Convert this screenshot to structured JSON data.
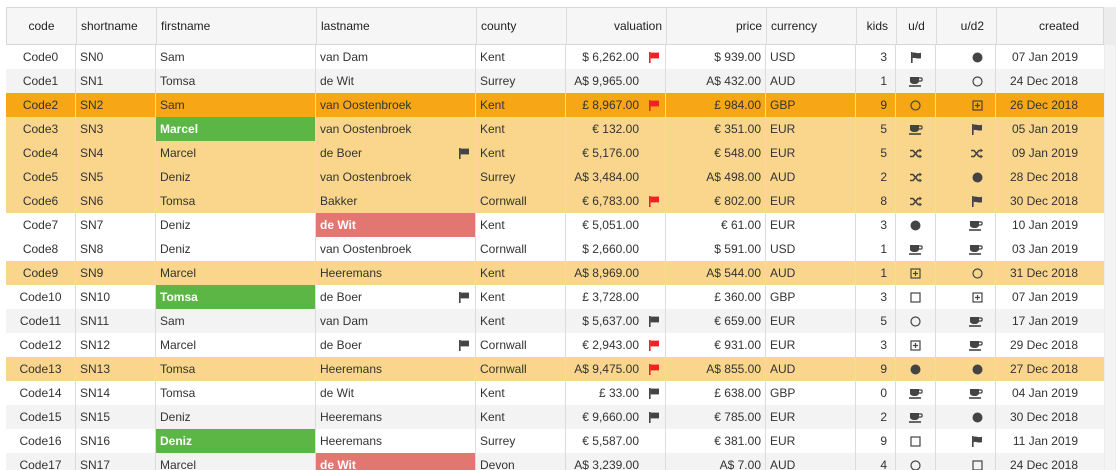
{
  "columns": {
    "code": "code",
    "shortname": "shortname",
    "firstname": "firstname",
    "lastname": "lastname",
    "county": "county",
    "valuation": "valuation",
    "price": "price",
    "currency": "currency",
    "kids": "kids",
    "ud": "u/d",
    "ud2": "u/d2",
    "created": "created"
  },
  "colors": {
    "selected": "#f7a715",
    "highlight": "#f9d68c",
    "green": "#5bb645",
    "red": "#e27670",
    "flag_red": "#ee2222",
    "flag_dark": "#555555"
  },
  "rows": [
    {
      "code": "Code0",
      "short": "SN0",
      "first": "Sam",
      "first_style": "",
      "last": "van Dam",
      "last_style": "",
      "last_flag": "",
      "county": "Kent",
      "val": "$ 6,262.00",
      "val_flag": "red",
      "price": "$ 939.00",
      "cur": "USD",
      "kids": "3",
      "ud": "flag",
      "ud2": "dot",
      "created": "07 Jan 2019",
      "state": "even"
    },
    {
      "code": "Code1",
      "short": "SN1",
      "first": "Tomsa",
      "first_style": "",
      "last": "de Wit",
      "last_style": "",
      "last_flag": "",
      "county": "Surrey",
      "val": "A$ 9,965.00",
      "val_flag": "",
      "price": "A$ 432.00",
      "cur": "AUD",
      "kids": "1",
      "ud": "cup",
      "ud2": "circle",
      "created": "24 Dec 2018",
      "state": "odd"
    },
    {
      "code": "Code2",
      "short": "SN2",
      "first": "Sam",
      "first_style": "",
      "last": "van Oostenbroek",
      "last_style": "",
      "last_flag": "",
      "county": "Kent",
      "val": "£ 8,967.00",
      "val_flag": "red",
      "price": "£ 984.00",
      "cur": "GBP",
      "kids": "9",
      "ud": "circle",
      "ud2": "plus",
      "created": "26 Dec 2018",
      "state": "sel"
    },
    {
      "code": "Code3",
      "short": "SN3",
      "first": "Marcel",
      "first_style": "green",
      "last": "van Oostenbroek",
      "last_style": "",
      "last_flag": "",
      "county": "Kent",
      "val": "€ 132.00",
      "val_flag": "",
      "price": "€ 351.00",
      "cur": "EUR",
      "kids": "5",
      "ud": "cup",
      "ud2": "flag",
      "created": "05 Jan 2019",
      "state": "hl"
    },
    {
      "code": "Code4",
      "short": "SN4",
      "first": "Marcel",
      "first_style": "",
      "last": "de Boer",
      "last_style": "",
      "last_flag": "dark",
      "county": "Kent",
      "val": "€ 5,176.00",
      "val_flag": "",
      "price": "€ 548.00",
      "cur": "EUR",
      "kids": "5",
      "ud": "shuffle",
      "ud2": "shuffle",
      "created": "09 Jan 2019",
      "state": "hl"
    },
    {
      "code": "Code5",
      "short": "SN5",
      "first": "Deniz",
      "first_style": "",
      "last": "van Oostenbroek",
      "last_style": "",
      "last_flag": "",
      "county": "Surrey",
      "val": "A$ 3,484.00",
      "val_flag": "",
      "price": "A$ 498.00",
      "cur": "AUD",
      "kids": "2",
      "ud": "shuffle",
      "ud2": "dot",
      "created": "28 Dec 2018",
      "state": "hl"
    },
    {
      "code": "Code6",
      "short": "SN6",
      "first": "Tomsa",
      "first_style": "",
      "last": "Bakker",
      "last_style": "",
      "last_flag": "",
      "county": "Cornwall",
      "val": "€ 6,783.00",
      "val_flag": "red",
      "price": "€ 802.00",
      "cur": "EUR",
      "kids": "8",
      "ud": "shuffle",
      "ud2": "flag",
      "created": "30 Dec 2018",
      "state": "hl"
    },
    {
      "code": "Code7",
      "short": "SN7",
      "first": "Deniz",
      "first_style": "",
      "last": "de Wit",
      "last_style": "red",
      "last_flag": "",
      "county": "Kent",
      "val": "€ 5,051.00",
      "val_flag": "",
      "price": "€ 61.00",
      "cur": "EUR",
      "kids": "3",
      "ud": "dot",
      "ud2": "cup",
      "created": "10 Jan 2019",
      "state": "even"
    },
    {
      "code": "Code8",
      "short": "SN8",
      "first": "Deniz",
      "first_style": "",
      "last": "van Oostenbroek",
      "last_style": "",
      "last_flag": "",
      "county": "Cornwall",
      "val": "$ 2,660.00",
      "val_flag": "",
      "price": "$ 591.00",
      "cur": "USD",
      "kids": "1",
      "ud": "cup",
      "ud2": "cup",
      "created": "03 Jan 2019",
      "state": "even"
    },
    {
      "code": "Code9",
      "short": "SN9",
      "first": "Marcel",
      "first_style": "",
      "last": "Heeremans",
      "last_style": "",
      "last_flag": "",
      "county": "Kent",
      "val": "A$ 8,969.00",
      "val_flag": "",
      "price": "A$ 544.00",
      "cur": "AUD",
      "kids": "1",
      "ud": "plus",
      "ud2": "circle",
      "created": "31 Dec 2018",
      "state": "hl"
    },
    {
      "code": "Code10",
      "short": "SN10",
      "first": "Tomsa",
      "first_style": "green",
      "last": "de Boer",
      "last_style": "",
      "last_flag": "dark",
      "county": "Kent",
      "val": "£ 3,728.00",
      "val_flag": "",
      "price": "£ 360.00",
      "cur": "GBP",
      "kids": "3",
      "ud": "square",
      "ud2": "plus",
      "created": "07 Jan 2019",
      "state": "even"
    },
    {
      "code": "Code11",
      "short": "SN11",
      "first": "Sam",
      "first_style": "",
      "last": "van Dam",
      "last_style": "",
      "last_flag": "",
      "county": "Kent",
      "val": "$ 5,637.00",
      "val_flag": "dark",
      "price": "€ 659.00",
      "cur": "EUR",
      "kids": "5",
      "ud": "circle",
      "ud2": "cup",
      "created": "17 Jan 2019",
      "state": "odd"
    },
    {
      "code": "Code12",
      "short": "SN12",
      "first": "Marcel",
      "first_style": "",
      "last": "de Boer",
      "last_style": "",
      "last_flag": "dark",
      "county": "Cornwall",
      "val": "€ 2,943.00",
      "val_flag": "red",
      "price": "€ 931.00",
      "cur": "EUR",
      "kids": "3",
      "ud": "plus",
      "ud2": "cup",
      "created": "29 Dec 2018",
      "state": "even"
    },
    {
      "code": "Code13",
      "short": "SN13",
      "first": "Tomsa",
      "first_style": "",
      "last": "Heeremans",
      "last_style": "",
      "last_flag": "",
      "county": "Cornwall",
      "val": "A$ 9,475.00",
      "val_flag": "red",
      "price": "A$ 855.00",
      "cur": "AUD",
      "kids": "9",
      "ud": "dot",
      "ud2": "dot",
      "created": "27 Dec 2018",
      "state": "hl"
    },
    {
      "code": "Code14",
      "short": "SN14",
      "first": "Tomsa",
      "first_style": "",
      "last": "de Wit",
      "last_style": "",
      "last_flag": "",
      "county": "Kent",
      "val": "£ 33.00",
      "val_flag": "dark",
      "price": "£ 638.00",
      "cur": "GBP",
      "kids": "0",
      "ud": "cup",
      "ud2": "cup",
      "created": "04 Jan 2019",
      "state": "even"
    },
    {
      "code": "Code15",
      "short": "SN15",
      "first": "Deniz",
      "first_style": "",
      "last": "Heeremans",
      "last_style": "",
      "last_flag": "",
      "county": "Kent",
      "val": "€ 9,660.00",
      "val_flag": "dark",
      "price": "€ 785.00",
      "cur": "EUR",
      "kids": "2",
      "ud": "cup",
      "ud2": "dot",
      "created": "30 Dec 2018",
      "state": "odd"
    },
    {
      "code": "Code16",
      "short": "SN16",
      "first": "Deniz",
      "first_style": "green",
      "last": "Heeremans",
      "last_style": "",
      "last_flag": "",
      "county": "Surrey",
      "val": "€ 5,587.00",
      "val_flag": "",
      "price": "€ 381.00",
      "cur": "EUR",
      "kids": "9",
      "ud": "square",
      "ud2": "flag",
      "created": "11 Jan 2019",
      "state": "even"
    },
    {
      "code": "Code17",
      "short": "SN17",
      "first": "Marcel",
      "first_style": "",
      "last": "de Wit",
      "last_style": "red",
      "last_flag": "",
      "county": "Devon",
      "val": "A$ 3,239.00",
      "val_flag": "",
      "price": "A$ 7.00",
      "cur": "AUD",
      "kids": "4",
      "ud": "circle",
      "ud2": "square",
      "created": "24 Dec 2018",
      "state": "odd"
    }
  ]
}
